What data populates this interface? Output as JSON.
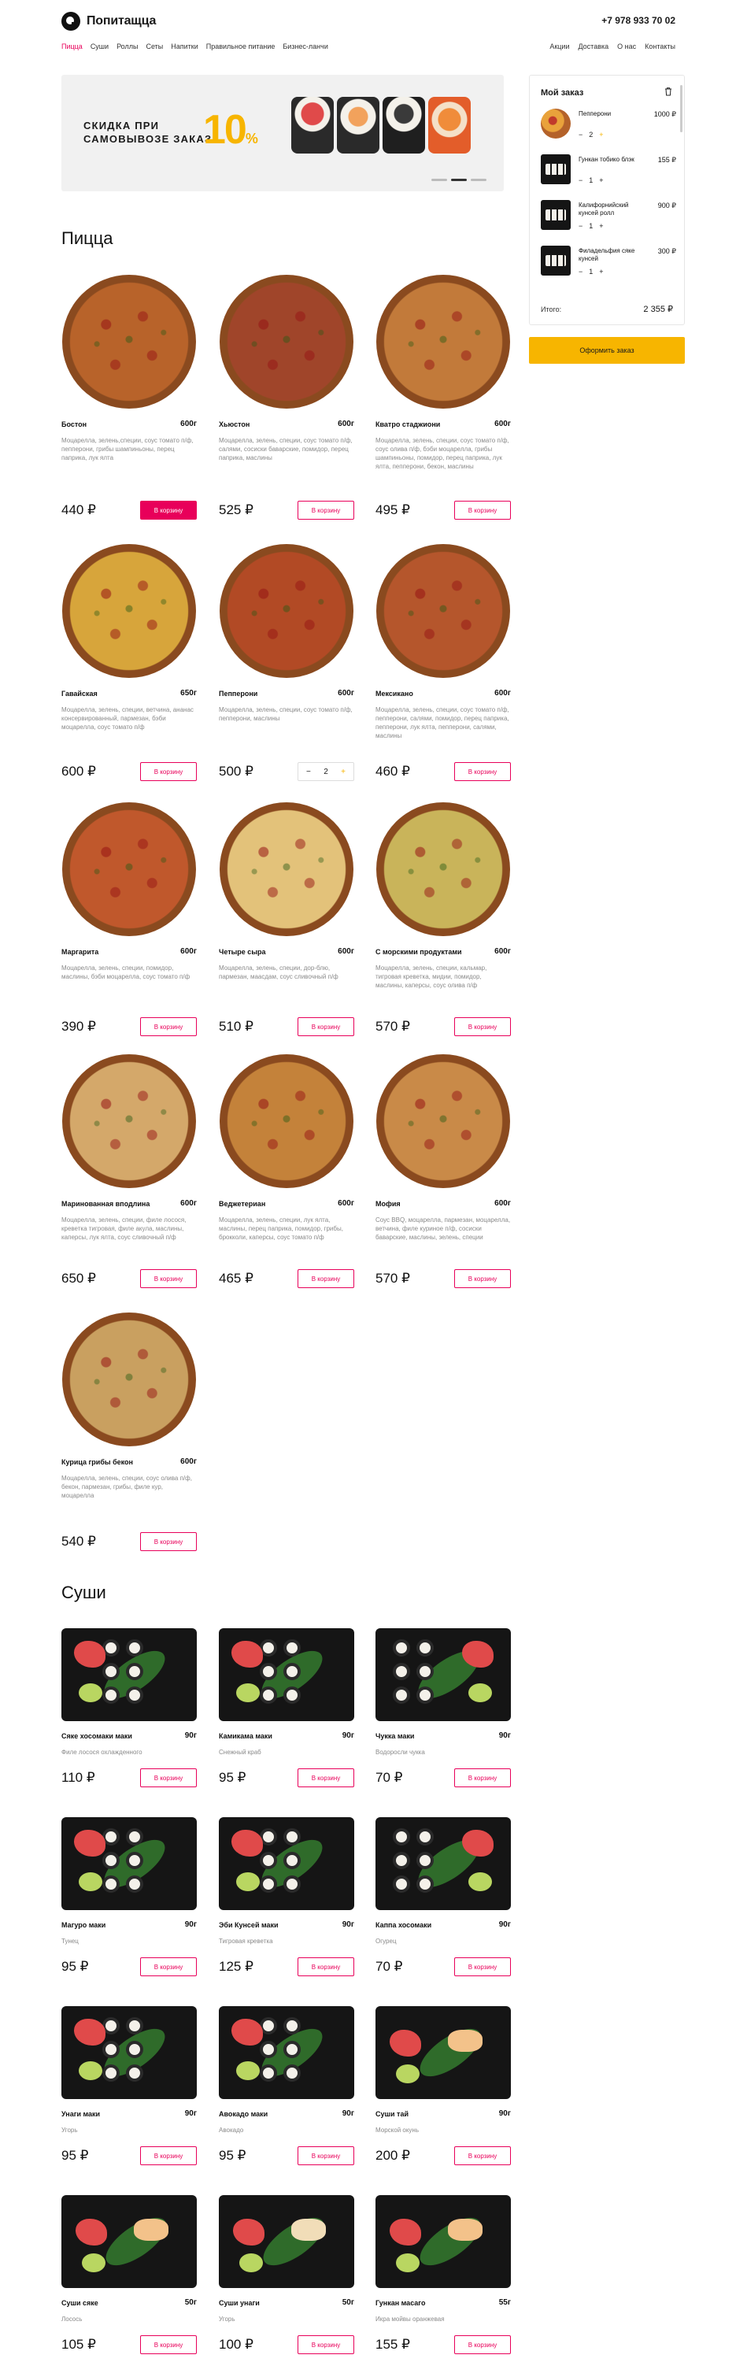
{
  "header": {
    "logo_text": "Попитащца",
    "phone": "+7 978 933 70 02"
  },
  "nav": {
    "left": [
      {
        "label": "Пицца",
        "active": true
      },
      {
        "label": "Суши",
        "active": false
      },
      {
        "label": "Роллы",
        "active": false
      },
      {
        "label": "Сеты",
        "active": false
      },
      {
        "label": "Напитки",
        "active": false
      },
      {
        "label": "Правильное питание",
        "active": false
      },
      {
        "label": "Бизнес-ланчи",
        "active": false
      }
    ],
    "right": [
      {
        "label": "Акции"
      },
      {
        "label": "Доставка"
      },
      {
        "label": "О нас"
      },
      {
        "label": "Контакты"
      }
    ]
  },
  "banner": {
    "line1": "СКИДКА ПРИ",
    "line2": "САМОВЫВОЗЕ ЗАКАЗА",
    "percent": "10",
    "percent_sign": "%",
    "slides": 3,
    "active_slide": 1
  },
  "sections": {
    "pizza_title": "Пицца",
    "sushi_title": "Суши"
  },
  "add_to_cart_label": "В корзину",
  "pizzas": [
    {
      "name": "Бостон",
      "weight": "600г",
      "desc": "Моцарелла, зелень,специи, соус томато п/ф, пепперони, грибы шампиньоны, перец паприка, лук ялта",
      "price": "440 ₽",
      "state": "filled",
      "color": "#b8632a"
    },
    {
      "name": "Хьюстон",
      "weight": "600г",
      "desc": "Моцарелла, зелень, специи, соус томато п/ф, салями, сосиски баварские, помидор, перец паприка, маслины",
      "price": "525 ₽",
      "state": "normal",
      "color": "#a0452a"
    },
    {
      "name": "Кватро стаджиони",
      "weight": "600г",
      "desc": "Моцарелла, зелень, специи, соус томато п/ф, соус олива п/ф, бэби моцарелла, грибы шампиньоны, помидор, перец паприка, лук ялта, пепперони, бекон, маслины",
      "price": "495 ₽",
      "state": "normal",
      "color": "#c27a3a"
    },
    {
      "name": "Гавайская",
      "weight": "650г",
      "desc": "Моцарелла, зелень, специи, ветчина, ананас консервированный, пармезан, бэби моцарелла, соус томато п/ф",
      "price": "600 ₽",
      "state": "normal",
      "color": "#d7a53b"
    },
    {
      "name": "Пепперони",
      "weight": "600г",
      "desc": "Моцарелла, зелень, специи, соус томато п/ф, пепперони, маслины",
      "price": "500 ₽",
      "state": "stepper",
      "qty": "2",
      "color": "#b24a25"
    },
    {
      "name": "Мексикано",
      "weight": "600г",
      "desc": "Моцарелла, зелень, специи, соус томато п/ф, пепперони, салями, помидор, перец паприка, пепперони, лук ялта, пепперони, салями, маслины",
      "price": "460 ₽",
      "state": "normal",
      "color": "#b5562c"
    },
    {
      "name": "Маргарита",
      "weight": "600г",
      "desc": "Моцарелла, зелень, специи, помидор, маслины, бэби моцарелла, соус томато п/ф",
      "price": "390 ₽",
      "state": "normal",
      "color": "#c0582c"
    },
    {
      "name": "Четыре сыра",
      "weight": "600г",
      "desc": "Моцарелла, зелень, специи, дор-блю, пармезан, маасдам, соус сливочный п/ф",
      "price": "510 ₽",
      "state": "normal",
      "color": "#e3c27a"
    },
    {
      "name": "С морскими продуктами",
      "weight": "600г",
      "desc": "Моцарелла, зелень, специи, кальмар, тигровая креветка, мидии, помидор, маслины, каперсы, соус олива п/ф",
      "price": "570 ₽",
      "state": "normal",
      "color": "#c9b45a"
    },
    {
      "name": "Маринованная вподлина",
      "weight": "600г",
      "desc": "Моцарелла, зелень, специи, филе лосося, креветка тигровая, филе акула, маслины, каперсы, лук ялта, соус сливочный п/ф",
      "price": "650 ₽",
      "state": "normal",
      "color": "#d4a86a"
    },
    {
      "name": "Веджетериан",
      "weight": "600г",
      "desc": "Моцарелла, зелень, специи, лук ялта, маслины, перец паприка, помидор, грибы, брокколи, каперсы, соус томато п/ф",
      "price": "465 ₽",
      "state": "normal",
      "color": "#c4823a"
    },
    {
      "name": "Мофия",
      "weight": "600г",
      "desc": "Соус BBQ, моцарелла, пармезан, моцарелла, ветчина, филе куриное п/ф, сосиски баварские, маслины, зелень, специи",
      "price": "570 ₽",
      "state": "normal",
      "color": "#c98a48"
    },
    {
      "name": "Курица грибы бекон",
      "weight": "600г",
      "desc": "Моцарелла, зелень, специи, соус олива п/ф, бекон, пармезан, грибы, филе кур, моцарелла",
      "price": "540 ₽",
      "state": "normal",
      "color": "#c9a060"
    }
  ],
  "sushi": [
    {
      "name": "Сяке хосомаки маки",
      "weight": "90г",
      "desc": "Филе лосося охлажденного",
      "price": "110 ₽"
    },
    {
      "name": "Камикама маки",
      "weight": "90г",
      "desc": "Снежный краб",
      "price": "95 ₽"
    },
    {
      "name": "Чукка маки",
      "weight": "90г",
      "desc": "Водоросли чукка",
      "price": "70 ₽"
    },
    {
      "name": "Магуро маки",
      "weight": "90г",
      "desc": "Тунец",
      "price": "95 ₽"
    },
    {
      "name": "Эби Кунсей маки",
      "weight": "90г",
      "desc": "Тигровая креветка",
      "price": "125 ₽"
    },
    {
      "name": "Каппа хосомаки",
      "weight": "90г",
      "desc": "Огурец",
      "price": "70 ₽"
    },
    {
      "name": "Унаги маки",
      "weight": "90г",
      "desc": "Угорь",
      "price": "95 ₽"
    },
    {
      "name": "Авокадо маки",
      "weight": "90г",
      "desc": "Авокадо",
      "price": "95 ₽"
    },
    {
      "name": "Суши тай",
      "weight": "90г",
      "desc": "Морской окунь",
      "price": "200 ₽"
    },
    {
      "name": "Суши сяке",
      "weight": "50г",
      "desc": "Лосось",
      "price": "105 ₽"
    },
    {
      "name": "Суши унаги",
      "weight": "50г",
      "desc": "Угорь",
      "price": "100 ₽"
    },
    {
      "name": "Гункан масаго",
      "weight": "55г",
      "desc": "Икра мойвы оранжевая",
      "price": "155 ₽"
    }
  ],
  "cart": {
    "title": "Мой заказ",
    "items": [
      {
        "name": "Пепперони",
        "price": "1000 ₽",
        "qty": "2",
        "thumb": "pizza"
      },
      {
        "name": "Гункан тобико блэк",
        "price": "155 ₽",
        "qty": "1",
        "thumb": "sushi"
      },
      {
        "name": "Калифорнийский кунсей ролл",
        "price": "900 ₽",
        "qty": "1",
        "thumb": "sushi"
      },
      {
        "name": "Филадельфия сяке кунсей",
        "price": "300 ₽",
        "qty": "1",
        "thumb": "sushi"
      }
    ],
    "total_label": "Итого:",
    "total": "2 355 ₽",
    "order_button": "Оформить заказ"
  },
  "colors": {
    "accent": "#e8005a",
    "yellow": "#f7b500"
  }
}
